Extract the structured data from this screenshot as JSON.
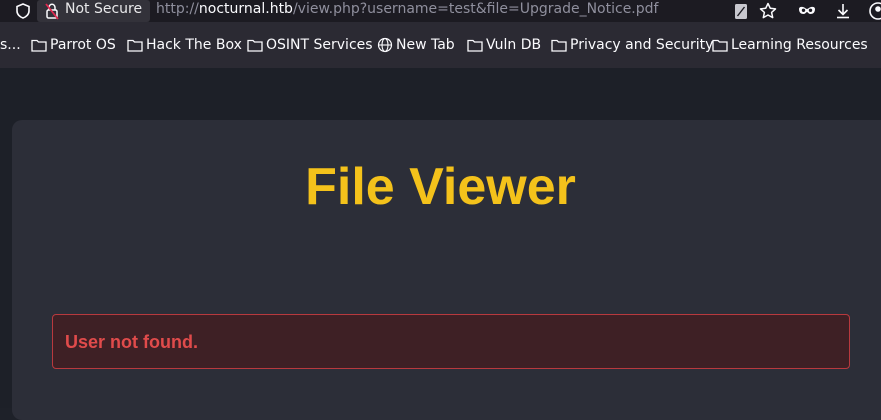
{
  "browser": {
    "security_label": "Not Secure",
    "url_prefix": "http://",
    "url_host": "nocturnal.htb",
    "url_path": "/view.php?username=test&file=Upgrade_Notice.pdf"
  },
  "bookmarks": [
    {
      "label": "s...",
      "icon": "none"
    },
    {
      "label": "Parrot OS",
      "icon": "folder-icon"
    },
    {
      "label": "Hack The Box",
      "icon": "folder-icon"
    },
    {
      "label": "OSINT Services",
      "icon": "folder-icon"
    },
    {
      "label": "New Tab",
      "icon": "globe-icon"
    },
    {
      "label": "Vuln DB",
      "icon": "folder-icon"
    },
    {
      "label": "Privacy and Security",
      "icon": "folder-icon"
    },
    {
      "label": "Learning Resources",
      "icon": "folder-icon"
    }
  ],
  "page": {
    "title": "File Viewer",
    "error_message": "User not found."
  },
  "colors": {
    "accent": "#f4c21b",
    "error_text": "#e04b4b",
    "error_border": "#b8393e",
    "error_bg": "#3e2025"
  }
}
